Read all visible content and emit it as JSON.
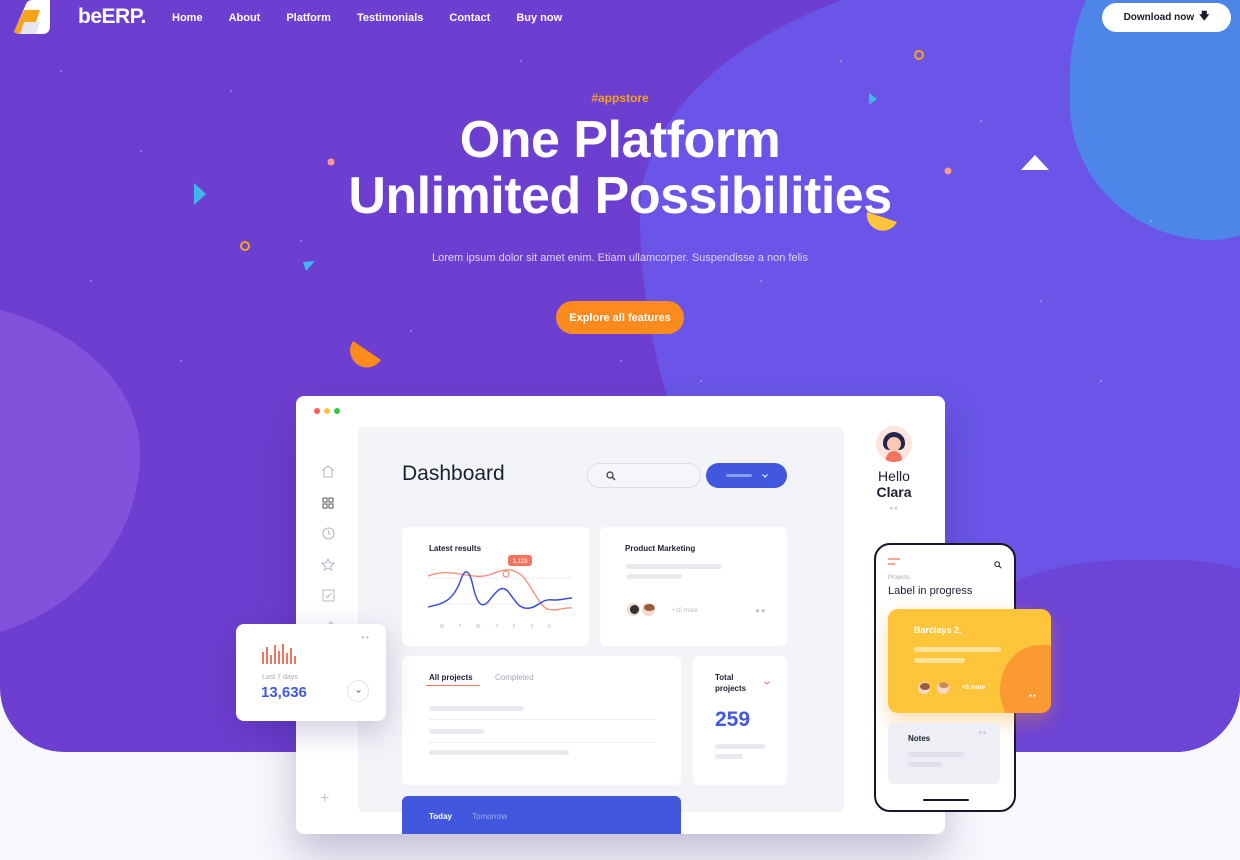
{
  "brand": {
    "name": "beERP."
  },
  "nav": {
    "links": [
      "Home",
      "About",
      "Platform",
      "Testimonials",
      "Contact",
      "Buy now"
    ],
    "download_label": "Download now"
  },
  "hero": {
    "tag": "#appstore",
    "headline_line1": "One Platform",
    "headline_line2": "Unlimited Possibilities",
    "subline": "Lorem ipsum dolor sit amet enim. Etiam ullamcorper. Suspendisse a non felis",
    "cta_label": "Explore all features"
  },
  "dashboard": {
    "title": "Dashboard",
    "latest_results": {
      "title": "Latest results",
      "tooltip": "1,123",
      "days": [
        "M",
        "T",
        "W",
        "T",
        "F",
        "S",
        "S"
      ]
    },
    "product_marketing": {
      "title": "Product Marketing",
      "more": "+10 more"
    },
    "projects_tabs": [
      "All projects",
      "Completed"
    ],
    "total_projects": {
      "label_line1": "Total",
      "label_line2": "projects",
      "value": "259"
    },
    "day_tabs": [
      "Today",
      "Tomorrow"
    ]
  },
  "profile": {
    "greeting": "Hello",
    "name": "Clara"
  },
  "stat_card": {
    "caption": "Last 7 days",
    "value": "13,636",
    "bars": [
      9,
      13,
      7,
      14,
      10,
      15,
      8,
      12,
      6
    ]
  },
  "phone": {
    "section_label": "Projects",
    "heading": "Label in progress",
    "card_title": "Barclays 2.",
    "card_more": "+5 more",
    "notes_title": "Notes"
  },
  "colors": {
    "hero_purple": "#6d3fd0",
    "accent_blue": "#4158de",
    "accent_orange": "#fb8b1e",
    "accent_yellow": "#fec53b",
    "tag_orange": "#f7a21b"
  }
}
